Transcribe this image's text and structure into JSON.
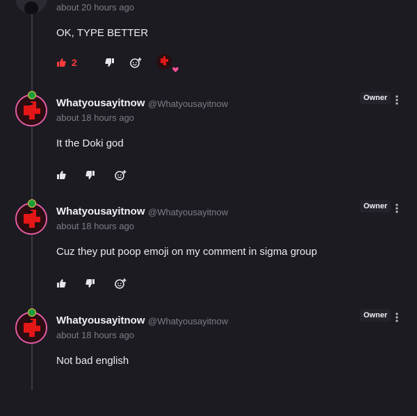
{
  "top_comment": {
    "timestamp": "about 20 hours ago",
    "text": "OK, TYPE BETTER",
    "like_count": "2"
  },
  "comments": [
    {
      "username": "Whatyousayitnow",
      "handle": "@Whatyousayitnow",
      "timestamp": "about 18 hours ago",
      "owner_label": "Owner",
      "text": "It the Doki god"
    },
    {
      "username": "Whatyousayitnow",
      "handle": "@Whatyousayitnow",
      "timestamp": "about 18 hours ago",
      "owner_label": "Owner",
      "text": "Cuz they put poop emoji on my comment in sigma group"
    },
    {
      "username": "Whatyousayitnow",
      "handle": "@Whatyousayitnow",
      "timestamp": "about 18 hours ago",
      "owner_label": "Owner",
      "text": "Not bad english"
    }
  ],
  "icons": {
    "like": "thumbs-up-icon",
    "dislike": "thumbs-down-icon",
    "react": "add-reaction-icon",
    "more": "kebab-menu-icon"
  },
  "colors": {
    "background": "#1c1b22",
    "like_active": "#ff3b3b",
    "avatar_ring": "#e45ca4",
    "heart": "#ff4f9a"
  }
}
